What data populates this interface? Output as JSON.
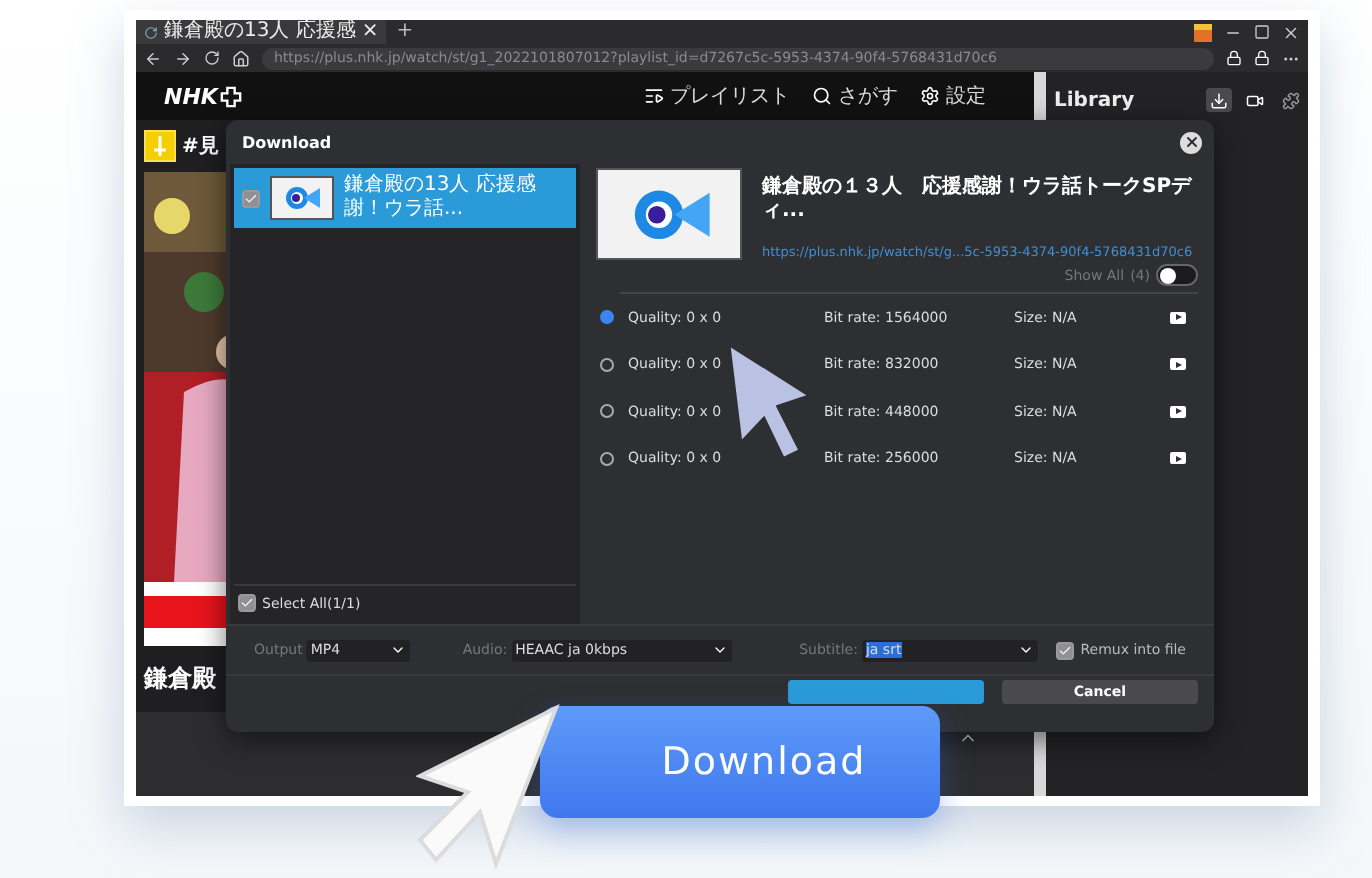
{
  "browser": {
    "tab": {
      "title": "鎌倉殿の13人 応援感",
      "close": "×"
    },
    "new_tab": "+",
    "url": "https://plus.nhk.jp/watch/st/g1_2022101807012?playlist_id=d7267c5c-5953-4374-90f4-5768431d70c6"
  },
  "site": {
    "logo": "NHK",
    "nav": [
      {
        "label": "プレイリスト"
      },
      {
        "label": "さがす"
      },
      {
        "label": "設定"
      }
    ],
    "hashtag": "#見",
    "caption": "鎌倉殿"
  },
  "library": {
    "title": "Library"
  },
  "dialog": {
    "title": "Download",
    "items": [
      {
        "title": "鎌倉殿の13人  応援感謝！ウラ話...",
        "checked": true,
        "selected": true
      }
    ],
    "select_all": {
      "label": "Select All(1/1)",
      "checked": true
    },
    "video": {
      "title": "鎌倉殿の１３人　応援感謝！ウラ話トークSPディ...",
      "link": "https://plus.nhk.jp/watch/st/g...5c-5953-4374-90f4-5768431d70c6"
    },
    "show_all": {
      "label": "Show All",
      "count": "(4)",
      "on": false
    },
    "qualities": [
      {
        "quality": "Quality: 0 x 0",
        "bitrate": "Bit rate: 1564000",
        "size": "Size: N/A",
        "selected": true
      },
      {
        "quality": "Quality: 0 x 0",
        "bitrate": "Bit rate: 832000",
        "size": "Size: N/A",
        "selected": false
      },
      {
        "quality": "Quality: 0 x 0",
        "bitrate": "Bit rate: 448000",
        "size": "Size: N/A",
        "selected": false
      },
      {
        "quality": "Quality: 0 x 0",
        "bitrate": "Bit rate: 256000",
        "size": "Size: N/A",
        "selected": false
      }
    ],
    "options": [
      {
        "label": "Output",
        "value": "MP4",
        "highlighted": false
      },
      {
        "label": "Audio:",
        "value": "HEAAC ja 0kbps",
        "highlighted": false
      },
      {
        "label": "Subtitle:",
        "value": "ja srt",
        "highlighted": true
      }
    ],
    "remux": {
      "label": "Remux into file",
      "checked": true
    },
    "cancel": "Cancel"
  },
  "promo_button": "Download"
}
